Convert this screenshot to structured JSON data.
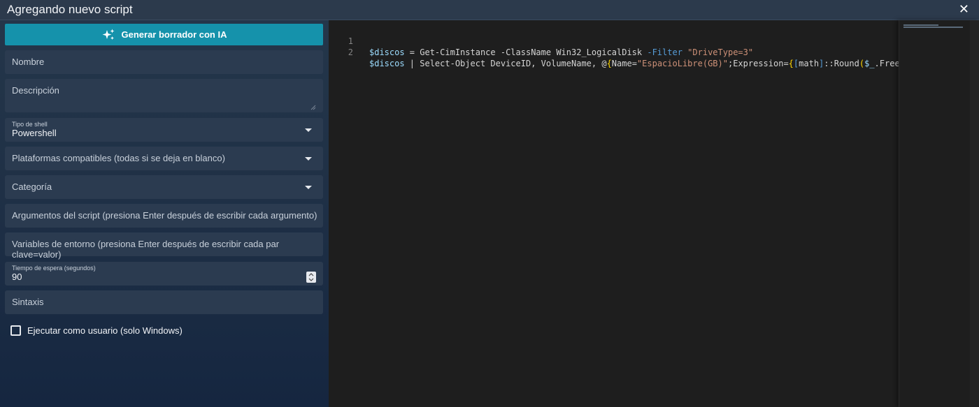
{
  "window": {
    "title": "Agregando nuevo script",
    "close_glyph": "✕"
  },
  "ai_button": {
    "label": "Generar borrador con IA",
    "icon": "sparkles-icon"
  },
  "form": {
    "name": {
      "label": "Nombre"
    },
    "description": {
      "label": "Descripción"
    },
    "shell": {
      "label": "Tipo de shell",
      "value": "Powershell"
    },
    "platforms": {
      "label": "Plataformas compatibles (todas si se deja en blanco)"
    },
    "category": {
      "label": "Categoría"
    },
    "args": {
      "label": "Argumentos del script (presiona Enter después de escribir cada argumento)"
    },
    "env": {
      "label": "Variables de entorno (presiona Enter después de escribir cada par clave=valor)"
    },
    "timeout": {
      "label": "Tiempo de espera (segundos)",
      "value": "90"
    },
    "syntax": {
      "label": "Sintaxis"
    },
    "run_as_user": {
      "label": "Ejecutar como usuario (solo Windows)",
      "checked": false
    }
  },
  "editor": {
    "line_numbers": [
      "1",
      "2"
    ],
    "line1": {
      "v1": "$discos",
      "t1": " = Get-CimInstance -ClassName Win32_LogicalDisk ",
      "p1": "-Filter",
      "t2": " ",
      "s1": "\"DriveType=3\""
    },
    "line2": {
      "v1": "$discos",
      "t1": " | Select-Object DeviceID, VolumeName, @",
      "b1": "{",
      "t2": "Name=",
      "s1": "\"EspacioLibre(GB)\"",
      "t3": ";Expression=",
      "b2": "{",
      "b3": "[",
      "t4": "math",
      "b4": "]",
      "t5": "::Round",
      "b5": "(",
      "v2": "$_",
      "t6": ".Free"
    }
  },
  "colors": {
    "accent": "#1592ab",
    "panel": "#2b3b50",
    "editor_bg": "#1e1e1e",
    "variable": "#9cdcfe",
    "string": "#ce9178",
    "parameter": "#569cd6"
  }
}
